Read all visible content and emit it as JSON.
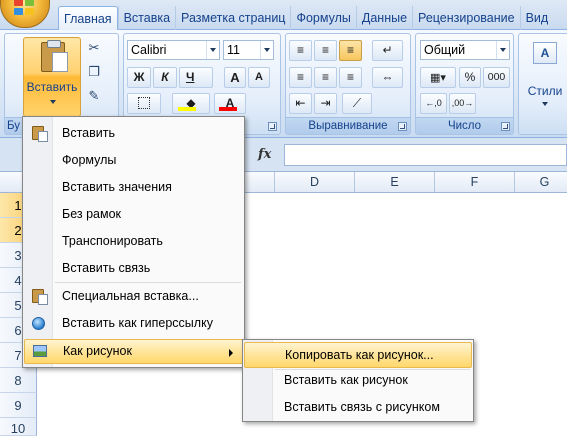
{
  "tabs": [
    "Главная",
    "Вставка",
    "Разметка страниц",
    "Формулы",
    "Данные",
    "Рецензирование",
    "Вид"
  ],
  "ribbon": {
    "clipboard": {
      "paste_label": "Вставить",
      "group_label_partial": "Бу"
    },
    "font": {
      "name": "Calibri",
      "size": "11",
      "bold": "Ж",
      "italic": "К",
      "underline": "Ч",
      "grow": "A",
      "shrink": "A",
      "color_letter": "A"
    },
    "alignment": {
      "group_label": "Выравнивание"
    },
    "number": {
      "format": "Общий",
      "percent": "%",
      "thousands": "000",
      "group_label": "Число",
      "currency_icon": "currency-icon"
    },
    "styles": {
      "label": "Стили"
    }
  },
  "formula_bar": {
    "fx": "fx"
  },
  "columns": [
    "D",
    "E",
    "F",
    "G"
  ],
  "rows": [
    "1",
    "2",
    "3",
    "4",
    "5",
    "6",
    "7",
    "8",
    "9",
    "10"
  ],
  "selected_rows": [
    "1",
    "2"
  ],
  "paste_menu": {
    "items": [
      {
        "label": "Вставить",
        "icon": "paste-icon"
      },
      {
        "label": "Формулы",
        "icon": ""
      },
      {
        "label": "Вставить значения",
        "icon": ""
      },
      {
        "label": "Без рамок",
        "icon": ""
      },
      {
        "label": "Транспонировать",
        "icon": ""
      },
      {
        "label": "Вставить связь",
        "icon": ""
      },
      {
        "label": "Специальная вставка...",
        "icon": "paste-special-icon"
      },
      {
        "label": "Вставить как гиперссылку",
        "icon": "hyperlink-icon"
      },
      {
        "label": "Как рисунок",
        "icon": "picture-icon",
        "highlighted": true,
        "has_submenu": true
      }
    ]
  },
  "picture_submenu": {
    "items": [
      {
        "label": "Копировать как рисунок...",
        "highlighted": true
      },
      {
        "label": "Вставить как рисунок"
      },
      {
        "label": "Вставить связь с рисунком"
      }
    ]
  },
  "colors": {
    "accent": "#15428b",
    "highlight": "#ffe59b",
    "font_color": "#ff0000",
    "fill_color": "#ffff00"
  }
}
